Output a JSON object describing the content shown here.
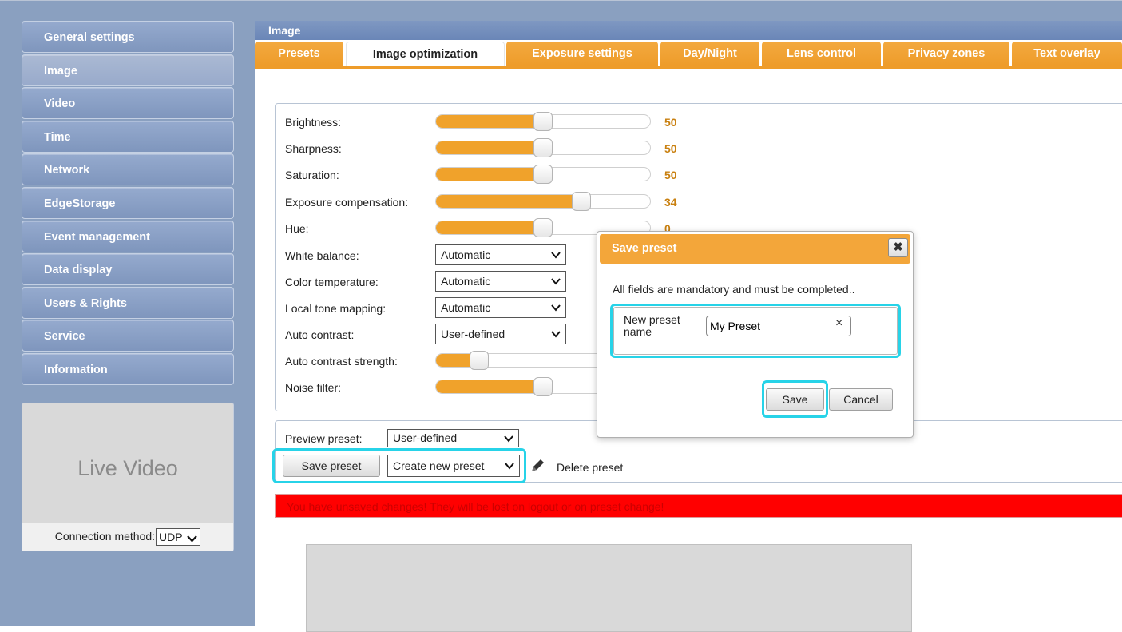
{
  "sidebar": {
    "items": [
      {
        "label": "General settings"
      },
      {
        "label": "Image"
      },
      {
        "label": "Video"
      },
      {
        "label": "Time"
      },
      {
        "label": "Network"
      },
      {
        "label": "EdgeStorage"
      },
      {
        "label": "Event management"
      },
      {
        "label": "Data display"
      },
      {
        "label": "Users & Rights"
      },
      {
        "label": "Service"
      },
      {
        "label": "Information"
      }
    ],
    "live_video": "Live Video",
    "connection_label": "Connection method:",
    "connection_value": "UDP"
  },
  "panel": {
    "title": "Image",
    "tabs": [
      {
        "label": "Presets"
      },
      {
        "label": "Image optimization"
      },
      {
        "label": "Exposure settings"
      },
      {
        "label": "Day/Night"
      },
      {
        "label": "Lens control"
      },
      {
        "label": "Privacy zones"
      },
      {
        "label": "Text overlay"
      }
    ]
  },
  "settings": {
    "sliders": [
      {
        "label": "Brightness:",
        "value": "50",
        "level": 0.5
      },
      {
        "label": "Sharpness:",
        "value": "50",
        "level": 0.5
      },
      {
        "label": "Saturation:",
        "value": "50",
        "level": 0.5
      },
      {
        "label": "Exposure compensation:",
        "value": "34",
        "level": 0.68
      },
      {
        "label": "Hue:",
        "value": "0",
        "level": 0.5
      }
    ],
    "selects": [
      {
        "label": "White balance:",
        "value": "Automatic"
      },
      {
        "label": "Color temperature:",
        "value": "Automatic"
      },
      {
        "label": "Local tone mapping:",
        "value": "Automatic"
      },
      {
        "label": "Auto contrast:",
        "value": "User-defined"
      }
    ],
    "auto_contrast_strength": {
      "label": "Auto contrast strength:",
      "level": 0.2
    },
    "noise_filter": {
      "label": "Noise filter:",
      "level": 0.5
    }
  },
  "preset_bar": {
    "preview_label": "Preview preset:",
    "preview_value": "User-defined",
    "save_button": "Save preset",
    "preset_select": "Create new preset",
    "delete_label": "Delete preset"
  },
  "warning": "You have unsaved changes! They will be lost on logout or on preset change!",
  "dialog": {
    "title": "Save preset",
    "close": "✖",
    "message": "All fields are mandatory and must be completed..",
    "field_label": "New preset name",
    "field_value": "My Preset",
    "clear": "×",
    "save": "Save",
    "cancel": "Cancel"
  },
  "colors": {
    "accent": "#f0a22b",
    "highlight": "#27d3e8",
    "warning": "#ff0000",
    "sidebar": "#8aa0c0"
  }
}
